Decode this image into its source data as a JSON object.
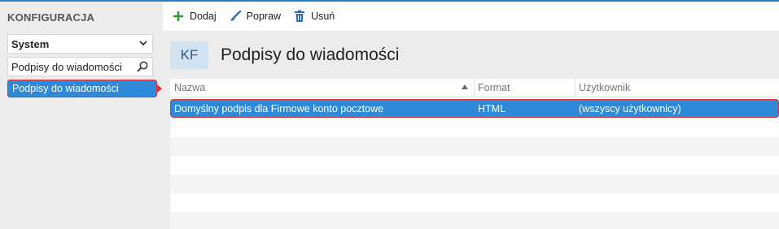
{
  "sidebar": {
    "title": "KONFIGURACJA",
    "select_value": "System",
    "search_value": "Podpisy do wiadomości",
    "tree_item": "Podpisy do wiadomości"
  },
  "toolbar": {
    "add_label": "Dodaj",
    "edit_label": "Popraw",
    "delete_label": "Usuń"
  },
  "page": {
    "badge": "KF",
    "title": "Podpisy do wiadomości"
  },
  "grid": {
    "columns": [
      "Nazwa",
      "Format",
      "Użytkownik"
    ],
    "rows": [
      {
        "name": "Domyślny podpis dla Firmowe konto pocztowe",
        "format": "HTML",
        "user": "(wszyscy użytkownicy)"
      }
    ]
  },
  "colors": {
    "accent": "#2e8ad8",
    "highlight_border": "#e03434",
    "add_icon": "#2e9a3a"
  },
  "icons": [
    "plus-icon",
    "brush-icon",
    "trash-icon",
    "search-icon",
    "chevron-down-icon",
    "sort-ascending-icon"
  ]
}
